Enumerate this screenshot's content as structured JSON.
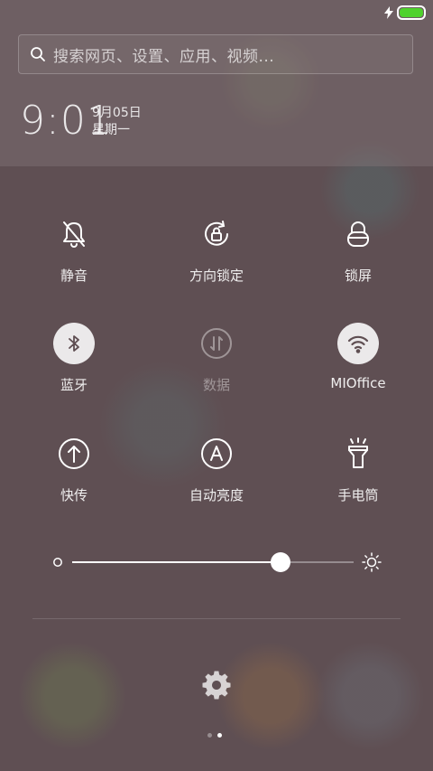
{
  "status_bar": {
    "battery_level": 1.0,
    "battery_color": "#4fd22d",
    "charging": true
  },
  "search": {
    "placeholder": "搜索网页、设置、应用、视频..."
  },
  "clock": {
    "time": "9:01",
    "date": "9月05日",
    "weekday": "星期一"
  },
  "toggles": [
    {
      "label": "静音",
      "icon": "bell-off-icon",
      "active": false
    },
    {
      "label": "方向锁定",
      "icon": "rotation-lock-icon",
      "active": false
    },
    {
      "label": "锁屏",
      "icon": "lock-icon",
      "active": false
    },
    {
      "label": "蓝牙",
      "icon": "bluetooth-icon",
      "active": true
    },
    {
      "label": "数据",
      "icon": "mobile-data-icon",
      "active": false,
      "disabled": true
    },
    {
      "label": "MIOffice",
      "icon": "wifi-icon",
      "active": true
    },
    {
      "label": "快传",
      "icon": "upload-arrow-icon",
      "active": false
    },
    {
      "label": "自动亮度",
      "icon": "auto-brightness-icon",
      "active": false
    },
    {
      "label": "手电筒",
      "icon": "flashlight-icon",
      "active": false
    }
  ],
  "brightness": {
    "level": 0.74
  },
  "pager": {
    "pages": 2,
    "current": 2
  }
}
